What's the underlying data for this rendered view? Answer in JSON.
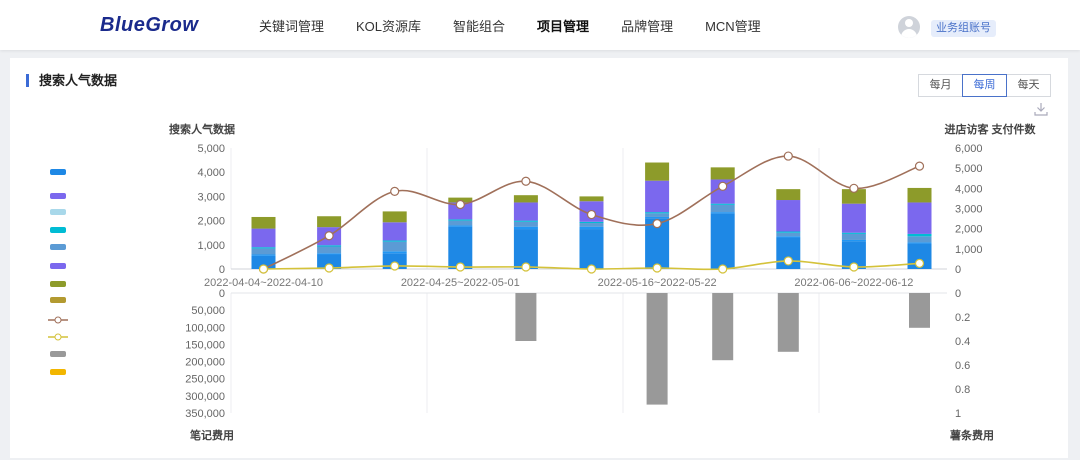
{
  "header": {
    "logo": "BlueGrow",
    "nav": [
      "关键词管理",
      "KOL资源库",
      "智能组合",
      "项目管理",
      "品牌管理",
      "MCN管理"
    ],
    "active_nav": "项目管理",
    "account_badge": "业务组账号"
  },
  "section": {
    "title": "搜索人气数据"
  },
  "period_buttons": [
    "每月",
    "每周",
    "每天"
  ],
  "active_period": "每周",
  "chart_data": {
    "type": "bar",
    "top_left_axis_title": "搜索人气数据",
    "top_right_axis_title": "进店访客 支付件数",
    "bottom_left_axis_title": "笔记费用",
    "bottom_right_axis_title": "薯条费用",
    "x_tick_labels": [
      "2022-04-04~2022-04-10",
      "2022-04-25~2022-05-01",
      "2022-05-16~2022-05-22",
      "2022-06-06~2022-06-12"
    ],
    "top_left_ylim": [
      0,
      5000
    ],
    "top_left_ticks": [
      "5,000",
      "4,000",
      "3,000",
      "2,000",
      "1,000",
      "0"
    ],
    "top_right_ylim": [
      0,
      6000
    ],
    "top_right_ticks": [
      "6,000",
      "5,000",
      "4,000",
      "3,000",
      "2,000",
      "1,000",
      "0"
    ],
    "bottom_left_ylim": [
      0,
      350000
    ],
    "bottom_left_ticks": [
      "0",
      "50,000",
      "100,000",
      "150,000",
      "200,000",
      "250,000",
      "300,000",
      "350,000"
    ],
    "bottom_right_ylim": [
      0,
      1
    ],
    "bottom_right_ticks": [
      "0",
      "0.2",
      "0.4",
      "0.6",
      "0.8",
      "1"
    ],
    "stack_colors": [
      "#1e88e5",
      "#2196f3",
      "#5b9bd5",
      "#00bcd4",
      "#7b68ee",
      "#8d9b2a"
    ],
    "stacked_bars": [
      [
        550,
        50,
        250,
        50,
        770,
        480
      ],
      [
        600,
        50,
        280,
        50,
        750,
        450
      ],
      [
        650,
        80,
        400,
        50,
        750,
        450
      ],
      [
        1750,
        50,
        200,
        50,
        700,
        200
      ],
      [
        1650,
        100,
        200,
        50,
        750,
        300
      ],
      [
        1650,
        100,
        150,
        50,
        850,
        200
      ],
      [
        2100,
        50,
        150,
        50,
        1300,
        750
      ],
      [
        2300,
        50,
        300,
        50,
        1000,
        500
      ],
      [
        1300,
        50,
        150,
        50,
        1300,
        450
      ],
      [
        1150,
        50,
        250,
        50,
        1200,
        600
      ],
      [
        1050,
        50,
        250,
        100,
        1300,
        600
      ]
    ],
    "visitor_line_color": "#a0705a",
    "visitors": [
      0,
      1650,
      3850,
      3200,
      4350,
      2700,
      2250,
      4100,
      5600,
      4000,
      5100
    ],
    "orders_line_color": "#d4c23a",
    "orders": [
      0,
      50,
      150,
      100,
      100,
      0,
      50,
      0,
      400,
      100,
      280
    ],
    "bottom_bar_color": "#999999",
    "note_fees": [
      0,
      0,
      0,
      0,
      0,
      0,
      0,
      0,
      0,
      0,
      0
    ],
    "chips_fees": [
      0,
      0,
      0,
      0,
      0.4,
      0,
      0.93,
      0.56,
      0.49,
      0,
      0.29
    ]
  }
}
